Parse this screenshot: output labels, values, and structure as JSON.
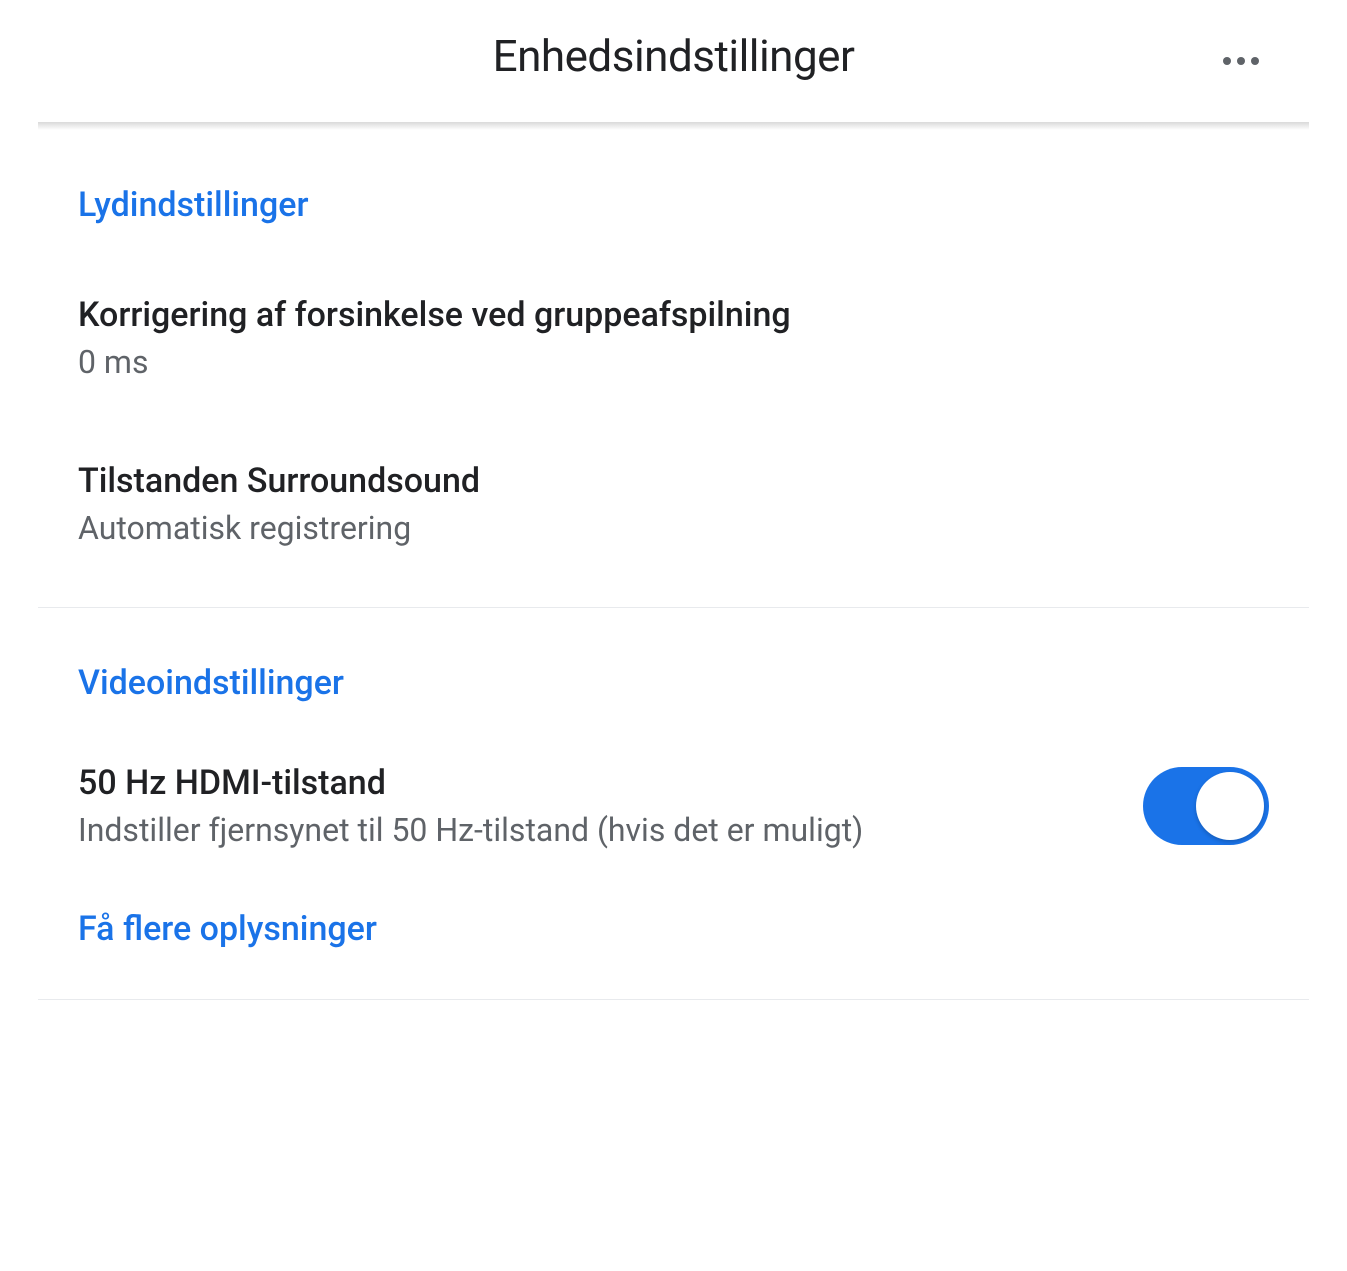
{
  "header": {
    "title": "Enhedsindstillinger"
  },
  "sections": {
    "audio": {
      "header": "Lydindstillinger",
      "delay_correction": {
        "title": "Korrigering af forsinkelse ved gruppeafspilning",
        "value": "0 ms"
      },
      "surround": {
        "title": "Tilstanden Surroundsound",
        "value": "Automatisk registrering"
      }
    },
    "video": {
      "header": "Videoindstillinger",
      "hdmi_50hz": {
        "title": "50 Hz HDMI-tilstand",
        "description": "Indstiller fjernsynet til 50 Hz-tilstand (hvis det er muligt)",
        "enabled": true
      },
      "more_info": "Få flere oplysninger"
    }
  }
}
